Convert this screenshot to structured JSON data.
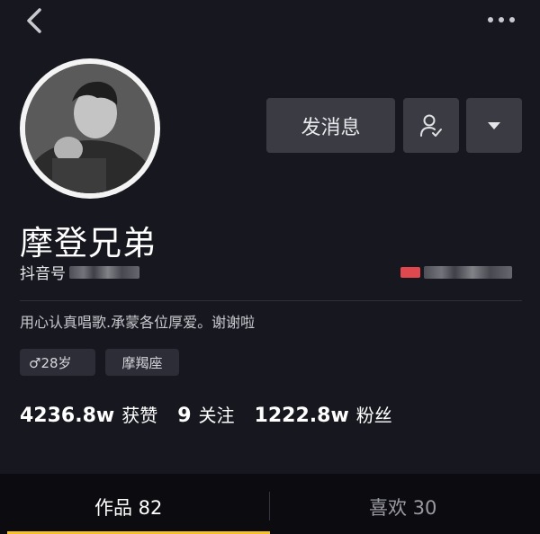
{
  "header": {
    "back_icon": "chevron-left-icon",
    "more_icon": "more-horizontal-icon"
  },
  "profile": {
    "nickname": "摩登兄弟",
    "douyin_id_label": "抖音号",
    "bio": "用心认真唱歌.承蒙各位厚爱。谢谢啦",
    "tags": [
      "♂28岁",
      "摩羯座"
    ]
  },
  "actions": {
    "message_label": "发消息",
    "follow_icon": "user-check-icon",
    "dropdown_icon": "caret-down-icon"
  },
  "stats": [
    {
      "value": "4236.8w",
      "label": "获赞"
    },
    {
      "value": "9",
      "label": "关注"
    },
    {
      "value": "1222.8w",
      "label": "粉丝"
    }
  ],
  "tabs": [
    {
      "label": "作品 82",
      "active": true
    },
    {
      "label": "喜欢 30",
      "active": false
    }
  ],
  "colors": {
    "background": "#17181f",
    "button": "#3a3b43",
    "accent": "#f7c12a",
    "red_chip": "#e0484f"
  }
}
